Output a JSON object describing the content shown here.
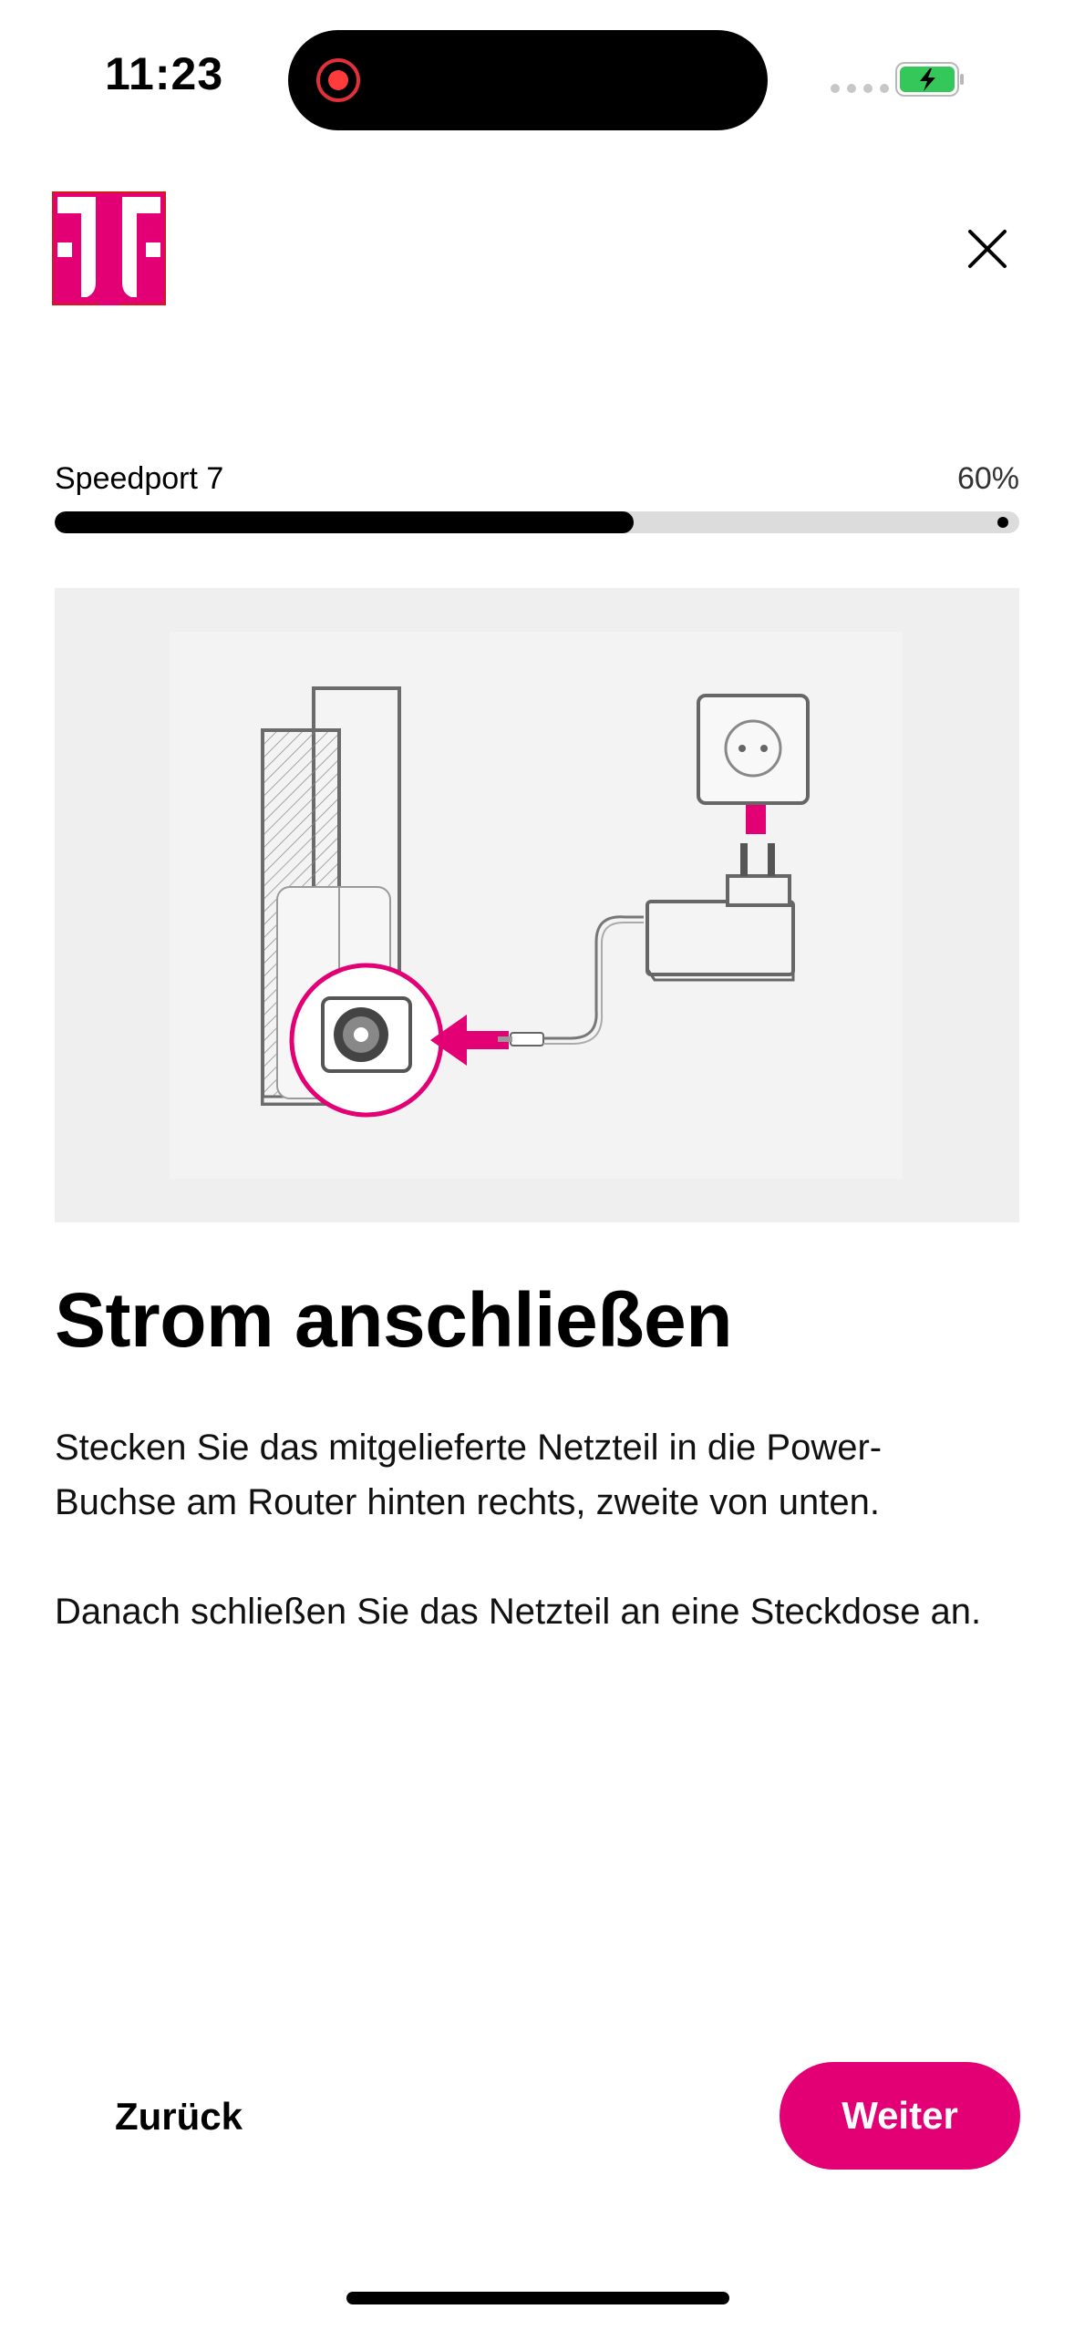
{
  "status_bar": {
    "time": "11:23",
    "recording_icon": "screen-recording-icon",
    "signal_icon": "cellular-signal-icon",
    "battery_icon": "battery-charging-icon",
    "battery_color": "#34c759"
  },
  "header": {
    "logo_icon": "telekom-logo-icon",
    "close_icon": "close-icon",
    "brand_color": "#e20074"
  },
  "progress": {
    "label": "Speedport 7",
    "percent_text": "60%",
    "value": 0.6
  },
  "illustration": {
    "icon": "router-power-connection-illustration"
  },
  "content": {
    "title": "Strom anschließen",
    "paragraph1": "Stecken Sie das mitgelieferte Netzteil in die Power-Buchse am Router hinten rechts, zweite von unten.",
    "paragraph2": "Danach schließen Sie das Netzteil an eine Steckdose an."
  },
  "footer": {
    "back_label": "Zurück",
    "next_label": "Weiter"
  }
}
